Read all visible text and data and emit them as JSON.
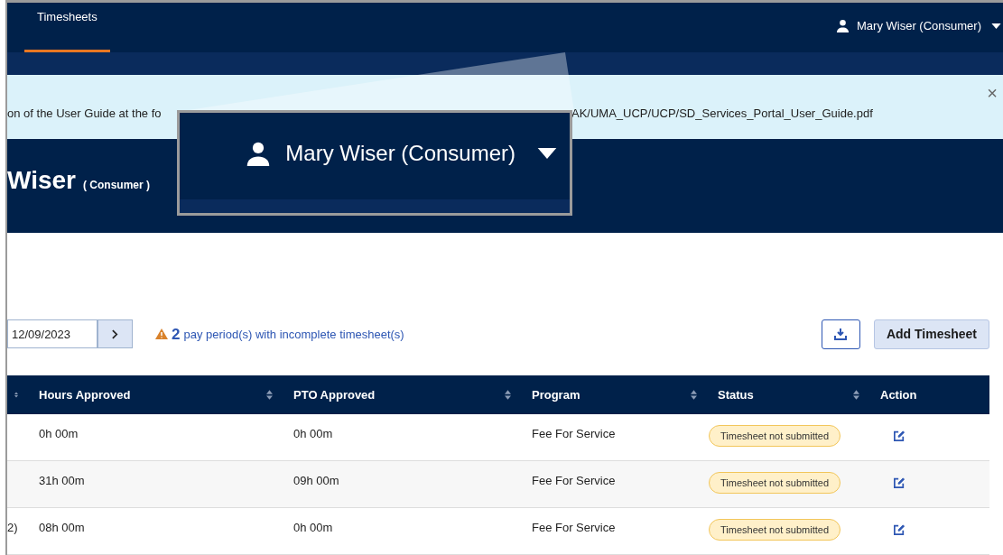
{
  "nav": {
    "tabs": [
      {
        "label": "Timesheets",
        "selected": true
      }
    ],
    "user_menu": {
      "label": "Mary Wiser (Consumer)"
    }
  },
  "banner": {
    "text_left": "on of the User Guide at the fo",
    "text_right": "AK/UMA_UCP/UCP/SD_Services_Portal_User_Guide.pdf",
    "close": "×"
  },
  "header": {
    "name": "Wiser",
    "role": "( Consumer )"
  },
  "callout": {
    "label": "Mary Wiser (Consumer)"
  },
  "toolbar": {
    "date_value": "12/09/2023",
    "warning_count": "2",
    "warning_text": "pay period(s) with incomplete timesheet(s)",
    "add_button": "Add Timesheet"
  },
  "table": {
    "columns": [
      {
        "kind": "sortable"
      },
      {
        "label": "Hours Approved",
        "kind": "sortable"
      },
      {
        "label": "PTO Approved",
        "kind": "sortable"
      },
      {
        "label": "Program",
        "kind": "sortable"
      },
      {
        "label": "Status",
        "kind": "sortable"
      },
      {
        "label": "Action",
        "kind": "plain"
      }
    ],
    "rows": [
      {
        "hours": "0h 00m",
        "pto": "0h 00m",
        "program": "Fee For Service",
        "status": "Timesheet not submitted"
      },
      {
        "hours": "31h 00m",
        "pto": "09h 00m",
        "program": "Fee For Service",
        "status": "Timesheet not submitted"
      },
      {
        "column_1": "2)",
        "hours": "08h 00m",
        "pto": "0h 00m",
        "program": "Fee For Service",
        "status": "Timesheet not submitted"
      }
    ]
  }
}
